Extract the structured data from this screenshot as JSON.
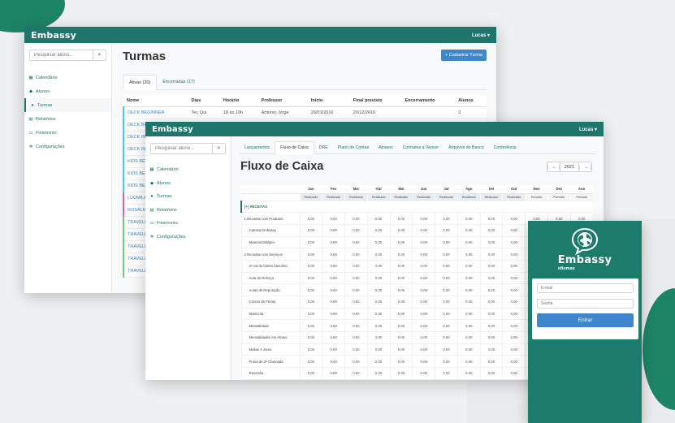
{
  "app": {
    "brand": "Embassy",
    "user": "Lucas ▾"
  },
  "search": {
    "placeholder": "Pesquisar aluno..."
  },
  "sidebar": {
    "items": [
      {
        "icon": "calendar-icon",
        "label": "Calendário"
      },
      {
        "icon": "students-icon",
        "label": "Alunos"
      },
      {
        "icon": "classes-icon",
        "label": "Turmas"
      },
      {
        "icon": "reports-icon",
        "label": "Relatórios"
      },
      {
        "icon": "finance-icon",
        "label": "Financeiro"
      },
      {
        "icon": "settings-icon",
        "label": "Configurações"
      }
    ]
  },
  "turmas": {
    "title": "Turmas",
    "add_button": "+ Cadastrar Turma",
    "tabs": [
      "Ativas (20)",
      "Encerradas (17)"
    ],
    "columns": [
      "Nome",
      "Dias",
      "Horário",
      "Professor",
      "Início",
      "Final previsto",
      "Encerramento",
      "Alunos"
    ],
    "rows": [
      [
        "DECK BEGINNER",
        "Ter, Qui",
        "18 às 19h",
        "Antonio Jorge",
        "26/01/2016",
        "20/12/2016",
        "",
        "3"
      ],
      [
        "DECK BE",
        "",
        "",
        "",
        "",
        "",
        "",
        ""
      ],
      [
        "DECK INT",
        "",
        "",
        "",
        "",
        "",
        "",
        ""
      ],
      [
        "DECK INT",
        "",
        "",
        "",
        "",
        "",
        "",
        ""
      ],
      [
        "KIDS BEG",
        "",
        "",
        "",
        "",
        "",
        "",
        ""
      ],
      [
        "KIDS BEG",
        "",
        "",
        "",
        "",
        "",
        "",
        ""
      ],
      [
        "KIDS BEG",
        "",
        "",
        "",
        "",
        "",
        "",
        ""
      ],
      [
        "LUDMILA",
        "",
        "",
        "",
        "",
        "",
        "",
        ""
      ],
      [
        "ROSÁLIA",
        "",
        "",
        "",
        "",
        "",
        "",
        ""
      ],
      [
        "TRAVELE",
        "",
        "",
        "",
        "",
        "",
        "",
        ""
      ],
      [
        "TRAVELE",
        "",
        "",
        "",
        "",
        "",
        "",
        ""
      ],
      [
        "TRAVELE",
        "",
        "",
        "",
        "",
        "",
        "",
        ""
      ],
      [
        "TRAVELE",
        "",
        "",
        "",
        "",
        "",
        "",
        ""
      ],
      [
        "TRAVELE",
        "",
        "",
        "",
        "",
        "",
        "",
        ""
      ]
    ]
  },
  "fluxo": {
    "tabs": [
      "Lançamentos",
      "Fluxo de Caixa",
      "DRE",
      "Plano de Contas",
      "Atrasos",
      "Contratos a Vencer",
      "Arquivos do Banco",
      "Conferência"
    ],
    "title": "Fluxo de Caixa",
    "year": "2021",
    "months": [
      "Jan",
      "Fev",
      "Mar",
      "Abr",
      "Mai",
      "Jun",
      "Jul",
      "Ago",
      "Set",
      "Out",
      "Nov",
      "Dez",
      "Ano"
    ],
    "status": [
      "Realizado",
      "Realizado",
      "Realizado",
      "Realizado",
      "Realizado",
      "Realizado",
      "Realizado",
      "Realizado",
      "Realizado",
      "Realizado",
      "Previsto",
      "Previsto",
      "Previsto"
    ],
    "section": "[+] RECEITAS",
    "rows": [
      {
        "label": "1.Receitas com Produtos",
        "indent": false
      },
      {
        "label": "Camisa Embassy",
        "indent": true
      },
      {
        "label": "Material Didático",
        "indent": true
      },
      {
        "label": "2.Receitas com Serviços",
        "indent": false
      },
      {
        "label": "2ª via do boleto bancário",
        "indent": true
      },
      {
        "label": "Aula de Reforço",
        "indent": true
      },
      {
        "label": "Aulas de Reposição",
        "indent": true
      },
      {
        "label": "Cursos de Férias",
        "indent": true
      },
      {
        "label": "Matrícula",
        "indent": true
      },
      {
        "label": "Mensalidade",
        "indent": true
      },
      {
        "label": "Mensalidades em Atraso",
        "indent": true
      },
      {
        "label": "Multas e Juros",
        "indent": true
      },
      {
        "label": "Prova de 2ª Chamada",
        "indent": true
      },
      {
        "label": "Rescisão",
        "indent": true
      }
    ],
    "cell_value": "0,00"
  },
  "login": {
    "logo_text": "Embassy",
    "logo_sub": "idiomas",
    "email_placeholder": "E-mail",
    "password_placeholder": "Senha",
    "submit": "Entrar"
  },
  "colors": {
    "primary": "#20756a",
    "button": "#3e87cb",
    "login_bg": "#1d7b6c"
  }
}
